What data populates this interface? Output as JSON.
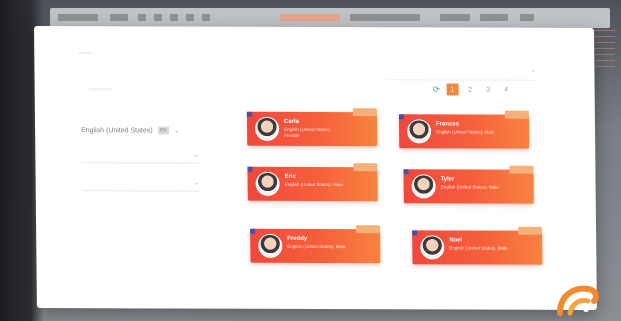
{
  "colors": {
    "card_start": "#f0473d",
    "card_end": "#f8833e",
    "accent_orange": "#f08a3c",
    "refresh_green": "#47b48a",
    "corner_marker": "#4b4ea6"
  },
  "language_select": {
    "value": "English (United States)",
    "flag_label": "EN"
  },
  "pagination": {
    "refresh_icon": "refresh-icon",
    "pages": [
      "1",
      "2",
      "3",
      "4"
    ],
    "active_page": "1"
  },
  "cards": [
    {
      "name": "Carla",
      "language": "English (United States)",
      "extra": "Female"
    },
    {
      "name": "Frances",
      "language": "English (United States), Male",
      "extra": ""
    },
    {
      "name": "Eric",
      "language": "English (United States), Male",
      "extra": ""
    },
    {
      "name": "Tyler",
      "language": "English (United States), Male",
      "extra": ""
    },
    {
      "name": "Freddy",
      "language": "English (United States), Male",
      "extra": ""
    },
    {
      "name": "Noel",
      "language": "English (United States), Male",
      "extra": ""
    }
  ]
}
